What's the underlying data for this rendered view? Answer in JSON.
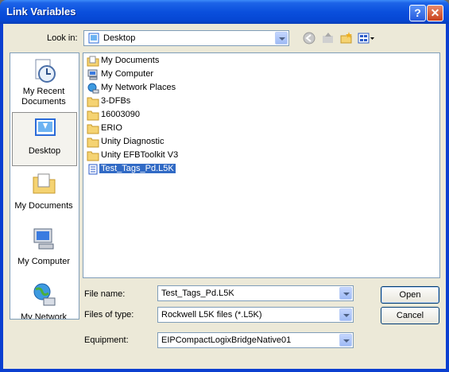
{
  "window": {
    "title": "Link Variables",
    "help_glyph": "?",
    "close_glyph": "✕"
  },
  "lookin": {
    "label": "Look in:",
    "value": "Desktop"
  },
  "places": [
    {
      "label": "My Recent Documents",
      "icon": "recent-documents-icon"
    },
    {
      "label": "Desktop",
      "icon": "desktop-icon",
      "selected": true
    },
    {
      "label": "My Documents",
      "icon": "my-documents-icon"
    },
    {
      "label": "My Computer",
      "icon": "my-computer-icon"
    },
    {
      "label": "My Network",
      "icon": "my-network-icon"
    }
  ],
  "files": [
    {
      "name": "My Documents",
      "icon": "my-documents-icon"
    },
    {
      "name": "My Computer",
      "icon": "my-computer-icon"
    },
    {
      "name": "My Network Places",
      "icon": "network-places-icon"
    },
    {
      "name": "3-DFBs",
      "icon": "folder-icon"
    },
    {
      "name": "16003090",
      "icon": "folder-icon"
    },
    {
      "name": "ERIO",
      "icon": "folder-icon"
    },
    {
      "name": "Unity Diagnostic",
      "icon": "folder-icon"
    },
    {
      "name": "Unity EFBToolkit V3",
      "icon": "folder-icon"
    },
    {
      "name": "Test_Tags_Pd.L5K",
      "icon": "file-icon",
      "selected": true
    }
  ],
  "filename": {
    "label": "File name:",
    "value": "Test_Tags_Pd.L5K"
  },
  "filetype": {
    "label": "Files of type:",
    "value": "Rockwell L5K files (*.L5K)"
  },
  "equipment": {
    "label": "Equipment:",
    "value": "EIPCompactLogixBridgeNative01"
  },
  "buttons": {
    "open": "Open",
    "cancel": "Cancel"
  },
  "colors": {
    "titlebar": "#0a4fdd",
    "selection": "#316ac5",
    "dialog": "#ece9d8",
    "folder": "#f5d372"
  }
}
